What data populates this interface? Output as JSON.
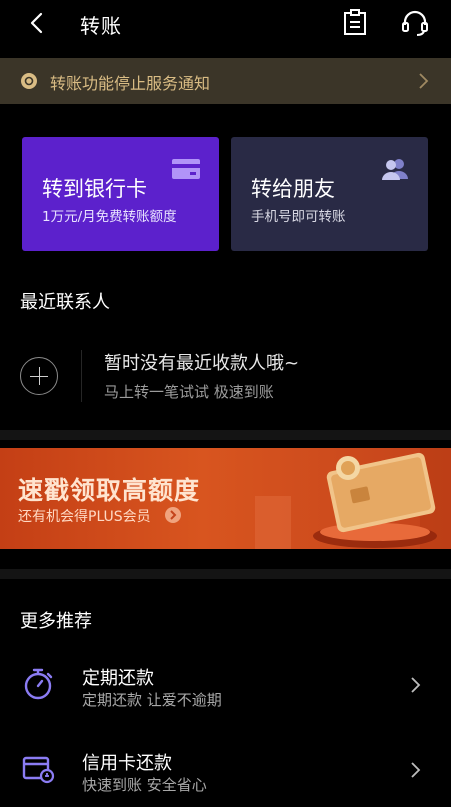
{
  "header": {
    "title": "转账",
    "icons": [
      "back-arrow-icon",
      "note-icon",
      "headset-icon"
    ]
  },
  "notice": {
    "text": "转账功能停止服务通知"
  },
  "cards": [
    {
      "title": "转到银行卡",
      "subtitle": "1万元/月免费转账额度",
      "icon": "bank-card-icon",
      "color": "#5c21cc"
    },
    {
      "title": "转给朋友",
      "subtitle": "手机号即可转账",
      "icon": "friends-icon",
      "color": "#292a45"
    }
  ],
  "recent": {
    "title": "最近联系人",
    "empty_title": "暂时没有最近收款人哦~",
    "empty_subtitle": "马上转一笔试试 极速到账"
  },
  "banner": {
    "title": "速戳领取高额度",
    "subtitle": "还有机会得PLUS会员"
  },
  "more": {
    "title": "更多推荐",
    "items": [
      {
        "title": "定期还款",
        "subtitle": "定期还款 让爱不逾期",
        "icon": "stopwatch-icon"
      },
      {
        "title": "信用卡还款",
        "subtitle": "快速到账 安全省心",
        "icon": "credit-card-icon"
      }
    ]
  },
  "colors": {
    "accent_purple": "#5c21cc",
    "notice_gold": "#d9bc84",
    "icon_purple": "#8b7cf3"
  }
}
